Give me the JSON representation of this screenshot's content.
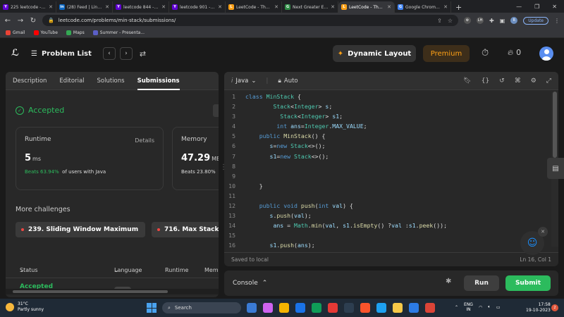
{
  "browser": {
    "tabs": [
      {
        "title": "225 leetcode - Y...",
        "fav": "Y",
        "color": "#6001d2",
        "active": false
      },
      {
        "title": "(28) Feed | Linke...",
        "fav": "in",
        "color": "#0a66c2",
        "active": false
      },
      {
        "title": "leetcode 844 - Y...",
        "fav": "Y",
        "color": "#6001d2",
        "active": false
      },
      {
        "title": "leetcode 901 - Y...",
        "fav": "Y",
        "color": "#6001d2",
        "active": false
      },
      {
        "title": "LeetCode - The W...",
        "fav": "L",
        "color": "#ffa116",
        "active": false
      },
      {
        "title": "Next Greater Ele...",
        "fav": "G",
        "color": "#2f8d46",
        "active": false
      },
      {
        "title": "LeetCode - The W...",
        "fav": "L",
        "color": "#ffa116",
        "active": true
      },
      {
        "title": "Google Chrome ...",
        "fav": "G",
        "color": "#4285f4",
        "active": false
      }
    ],
    "url": "leetcode.com/problems/min-stack/submissions/",
    "update_label": "Update",
    "bookmarks": [
      {
        "label": "Gmail",
        "color": "#ea4335"
      },
      {
        "label": "YouTube",
        "color": "#ff0000"
      },
      {
        "label": "Maps",
        "color": "#34a853"
      },
      {
        "label": "Summer - Presenta...",
        "color": "#5b5fc7"
      }
    ]
  },
  "header": {
    "problem_list": "Problem List",
    "dynamic_layout": "Dynamic Layout",
    "premium": "Premium",
    "streak_count": "0"
  },
  "left": {
    "tabs": [
      "Description",
      "Editorial",
      "Solutions",
      "Submissions"
    ],
    "status": "Accepted",
    "runtime": {
      "title": "Runtime",
      "details": "Details",
      "value": "5",
      "unit": "ms",
      "beats": "Beats 63.94%",
      "beats_suffix": "of users with Java"
    },
    "memory": {
      "title": "Memory",
      "value": "47.29",
      "unit": "MB",
      "beats": "Beats 23.80%"
    },
    "more_challenges": "More challenges",
    "challenges": [
      "239. Sliding Window Maximum",
      "716. Max Stack"
    ],
    "table_headers": [
      "Status",
      "Language",
      "Runtime",
      "Memory"
    ],
    "row_status": "Accepted"
  },
  "editor": {
    "language": "Java",
    "mode": "Auto",
    "lines": [
      {
        "n": "1",
        "html": "<span class='kw'>class</span> <span class='ty'>MinStack</span> {"
      },
      {
        "n": "2",
        "html": "        <span class='ty'>Stack</span>&lt;<span class='ty'>Integer</span>&gt; <span class='vr'>s</span>;"
      },
      {
        "n": "3",
        "html": "          <span class='ty'>Stack</span>&lt;<span class='ty'>Integer</span>&gt; <span class='vr'>s1</span>;"
      },
      {
        "n": "4",
        "html": "         <span class='kw'>int</span> <span class='vr'>ans</span>=<span class='ty'>Integer</span>.<span class='vr'>MAX_VALUE</span>;"
      },
      {
        "n": "5",
        "html": "    <span class='kw'>public</span> <span class='fn'>MinStack</span>() {"
      },
      {
        "n": "6",
        "html": "       <span class='vr'>s</span>=<span class='kw'>new</span> <span class='ty'>Stack</span>&lt;&gt;();"
      },
      {
        "n": "7",
        "html": "       <span class='vr'>s1</span>=<span class='kw'>new</span> <span class='ty'>Stack</span>&lt;&gt;();"
      },
      {
        "n": "8",
        "html": ""
      },
      {
        "n": "9",
        "html": ""
      },
      {
        "n": "10",
        "html": "    }"
      },
      {
        "n": "11",
        "html": ""
      },
      {
        "n": "12",
        "html": "    <span class='kw'>public</span> <span class='kw'>void</span> <span class='fn'>push</span>(<span class='kw'>int</span> <span class='vr'>val</span>) {"
      },
      {
        "n": "13",
        "html": "       <span class='vr'>s</span>.<span class='fn'>push</span>(<span class='vr'>val</span>);"
      },
      {
        "n": "14",
        "html": "        <span class='vr'>ans</span> = <span class='ty'>Math</span>.<span class='fn'>min</span>(<span class='vr'>val</span>, <span class='vr'>s1</span>.<span class='fn'>isEmpty</span>() ?<span class='vr'>val</span> :<span class='vr'>s1</span>.<span class='fn'>peek</span>());"
      },
      {
        "n": "15",
        "html": ""
      },
      {
        "n": "16",
        "html": "       <span class='vr'>s1</span>.<span class='fn'>push</span>(<span class='vr'>ans</span>);"
      }
    ],
    "saved": "Saved to local",
    "cursor": "Ln 16, Col 1"
  },
  "console": {
    "label": "Console",
    "run": "Run",
    "submit": "Submit"
  },
  "taskbar": {
    "temp": "31°C",
    "weather": "Partly sunny",
    "search": "Search",
    "lang": "ENG",
    "region": "IN",
    "time": "17:58",
    "date": "19-10-2023",
    "notif": "2",
    "apps": [
      "#3a7bd5",
      "#ce63f0",
      "#f4b400",
      "#1a73e8",
      "#0f9d58",
      "#e53935",
      "#2d3e50",
      "#fb542b",
      "#1ea1f1",
      "#f7c948",
      "#2c7be5",
      "#db4437"
    ]
  }
}
